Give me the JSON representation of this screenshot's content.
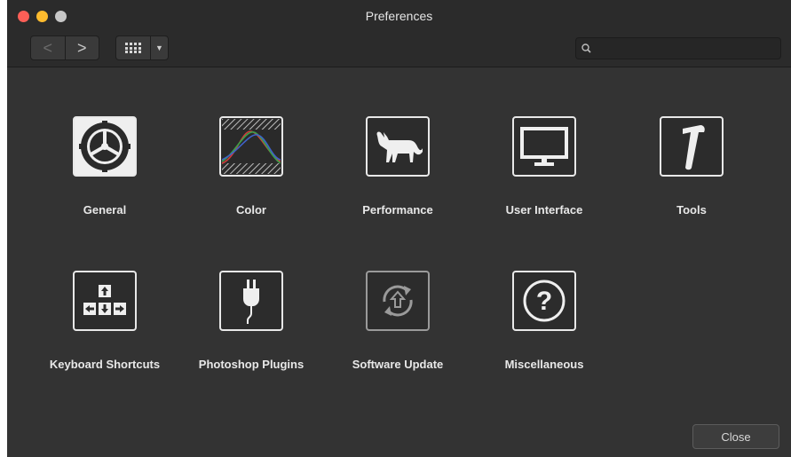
{
  "window": {
    "title": "Preferences"
  },
  "toolbar": {
    "back_glyph": "<",
    "forward_glyph": ">",
    "search_placeholder": "",
    "search_value": ""
  },
  "items": [
    {
      "label": "General",
      "icon": "gear-icon"
    },
    {
      "label": "Color",
      "icon": "color-curves-icon"
    },
    {
      "label": "Performance",
      "icon": "cat-icon"
    },
    {
      "label": "User Interface",
      "icon": "monitor-icon"
    },
    {
      "label": "Tools",
      "icon": "hammer-icon"
    },
    {
      "label": "Keyboard Shortcuts",
      "icon": "keyboard-arrows-icon"
    },
    {
      "label": "Photoshop Plugins",
      "icon": "plug-icon"
    },
    {
      "label": "Software Update",
      "icon": "update-arrows-icon"
    },
    {
      "label": "Miscellaneous",
      "icon": "question-icon"
    }
  ],
  "footer": {
    "close_label": "Close"
  }
}
